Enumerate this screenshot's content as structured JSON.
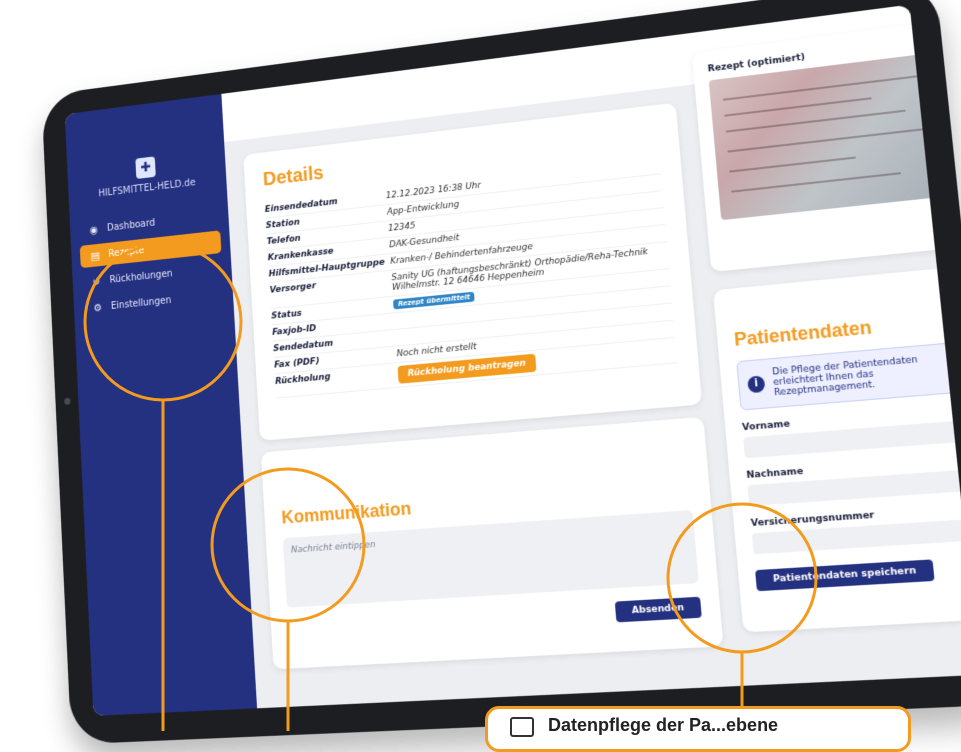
{
  "brand": {
    "name": "HILFSMITTEL-HELD.de"
  },
  "sidebar": {
    "items": [
      {
        "label": "Dashboard",
        "icon": "dashboard-icon",
        "active": false
      },
      {
        "label": "Rezepte",
        "icon": "document-icon",
        "active": true
      },
      {
        "label": "Rückholungen",
        "icon": "return-icon",
        "active": false
      },
      {
        "label": "Einstellungen",
        "icon": "gear-icon",
        "active": false
      }
    ]
  },
  "details": {
    "title": "Details",
    "rows": [
      {
        "label": "Einsendedatum",
        "value": "12.12.2023 16:38 Uhr"
      },
      {
        "label": "Station",
        "value": "App-Entwicklung"
      },
      {
        "label": "Telefon",
        "value": "12345"
      },
      {
        "label": "Krankenkasse",
        "value": "DAK-Gesundheit"
      },
      {
        "label": "Hilfsmittel-Hauptgruppe",
        "value": "Kranken-/ Behindertenfahrzeuge"
      },
      {
        "label": "Versorger",
        "value": "Sanity UG (haftungsbeschränkt) Orthopädie/Reha-Technik Wilhelmstr. 12 64646 Heppenheim"
      },
      {
        "label": "Status",
        "value": ""
      },
      {
        "label": "Faxjob-ID",
        "value": ""
      },
      {
        "label": "Sendedatum",
        "value": ""
      },
      {
        "label": "Fax (PDF)",
        "value": "Noch nicht erstellt"
      },
      {
        "label": "Rückholung",
        "value": ""
      }
    ],
    "status_badge": "Rezept übermittelt",
    "rueckholung_button": "Rückholung beantragen"
  },
  "kommunikation": {
    "title": "Kommunikation",
    "placeholder": "Nachricht eintippen",
    "send_button": "Absenden"
  },
  "rezept": {
    "title": "Rezept (optimiert)"
  },
  "patient": {
    "title": "Patientendaten",
    "info": "Die Pflege der Patientendaten erleichtert Ihnen das Rezeptmanagement.",
    "fields": [
      "Vorname",
      "Nachname",
      "Versicherungsnummer"
    ],
    "save_button": "Patientendaten speichern"
  },
  "callout": {
    "text": "Datenpflege der Pa...ebene"
  },
  "colors": {
    "navy": "#243080",
    "orange": "#f39b1f"
  }
}
